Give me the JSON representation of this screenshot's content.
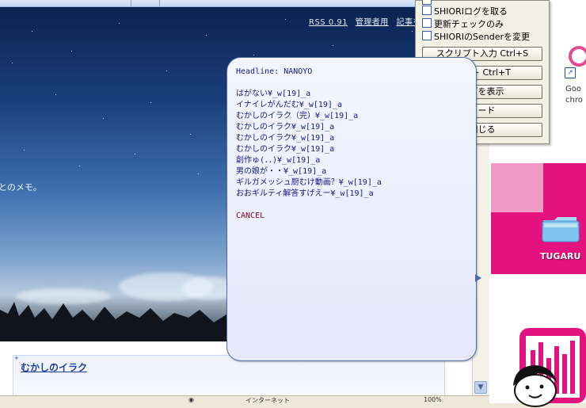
{
  "blog": {
    "header_links": [
      "RSS 0.91",
      "管理者用",
      "記事を"
    ],
    "memo_text": "とのメモ。",
    "entry_title": "むかしのイラク"
  },
  "menu": {
    "checkbox_items": [
      {
        "label": "SHIORIログを取る",
        "checked": false
      },
      {
        "label": "更新チェックのみ",
        "checked": false
      },
      {
        "label": "SHIORIのSenderを変更",
        "checked": false
      }
    ],
    "buttons": [
      "スクリプト入力 Ctrl+S",
      "テスト Ctrl+T",
      "ログを表示",
      "ロード",
      "閉じる"
    ]
  },
  "balloon": {
    "headline": "Headline: NANOYO",
    "items": [
      "はがない¥_w[19]_a",
      "イナイレがんだむ¥_w[19]_a",
      "むかしのイラク（完）¥_w[19]_a",
      "むかしのイラク¥_w[19]_a",
      "むかしのイラク¥_w[19]_a",
      "むかしのイラク¥_w[19]_a",
      "創作ゅ(．．)¥_w[19]_a",
      "男の娘が・・¥_w[19]_a",
      "ギルガメッシュ厨むけ動画？¥_w[19]_a",
      "おおギルティ解答すげえー¥_w[19]_a"
    ],
    "cancel": "CANCEL"
  },
  "desktop": {
    "folder_label": "TUGARU",
    "chrome_label_line1": "Goo",
    "chrome_label_line2": "chro"
  },
  "statusbar": {
    "zone_text": "インターネット",
    "zoom": "100%"
  }
}
